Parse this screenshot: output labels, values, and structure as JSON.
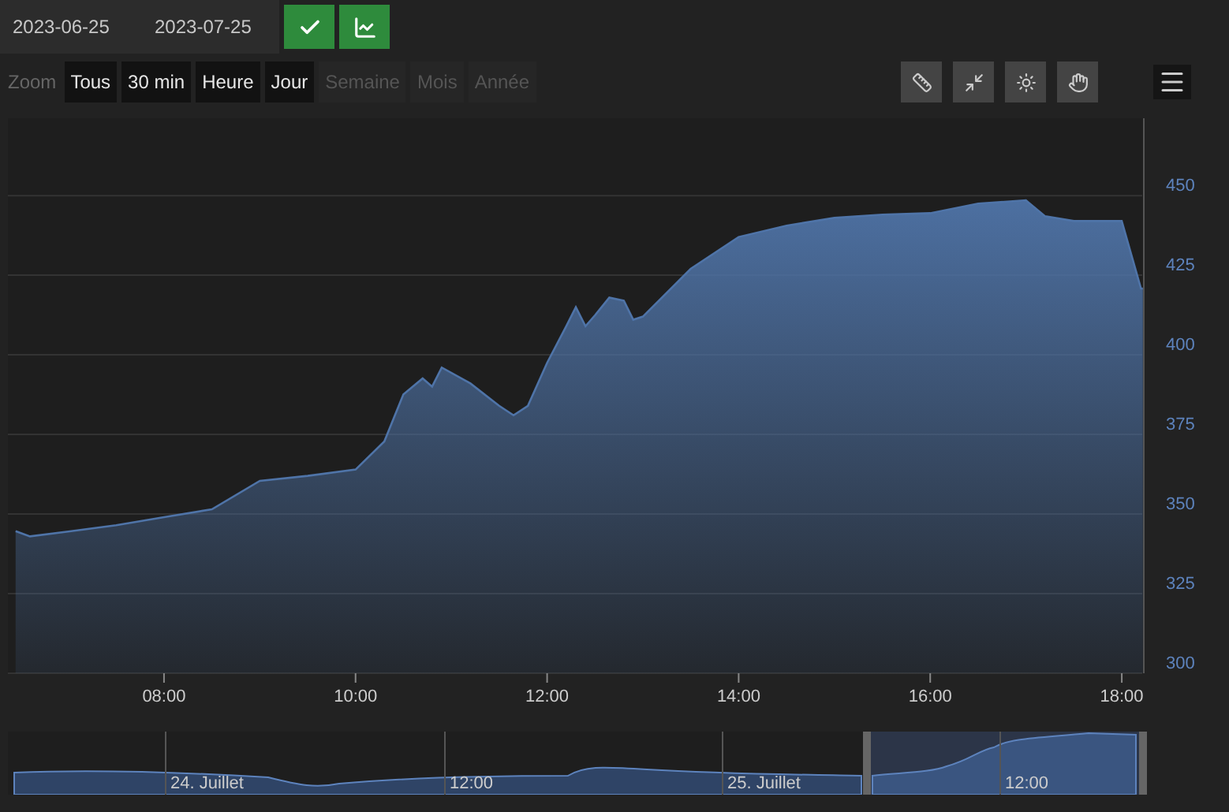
{
  "date_range": {
    "start": "2023-06-25",
    "end": "2023-07-25"
  },
  "zoom": {
    "label": "Zoom",
    "buttons": [
      {
        "label": "Tous",
        "disabled": false
      },
      {
        "label": "30 min",
        "disabled": false
      },
      {
        "label": "Heure",
        "disabled": false
      },
      {
        "label": "Jour",
        "disabled": false
      },
      {
        "label": "Semaine",
        "disabled": true
      },
      {
        "label": "Mois",
        "disabled": true
      },
      {
        "label": "Année",
        "disabled": true
      }
    ]
  },
  "chart": {
    "chart_data": {
      "type": "area",
      "x": [
        6.45,
        6.6,
        7.0,
        7.5,
        8.0,
        8.5,
        9.0,
        9.5,
        10.0,
        10.3,
        10.5,
        10.7,
        10.8,
        10.9,
        11.2,
        11.5,
        11.65,
        11.8,
        12.0,
        12.2,
        12.3,
        12.4,
        12.5,
        12.65,
        12.8,
        12.9,
        13.0,
        13.5,
        14.0,
        14.5,
        15.0,
        15.5,
        16.0,
        16.5,
        17.0,
        17.2,
        17.5,
        18.0,
        18.2,
        18.22
      ],
      "series": [
        {
          "color": "#4f74a8",
          "values": [
            344.6,
            343,
            344.5,
            346.5,
            349,
            351.5,
            360.4,
            362,
            364,
            372.8,
            387.6,
            392.6,
            390,
            396,
            391,
            384,
            381,
            384,
            397.5,
            409,
            415,
            409,
            412.4,
            418,
            417,
            411,
            412,
            427,
            437,
            440.6,
            443,
            444,
            444.5,
            447.5,
            448.5,
            443.5,
            442,
            442,
            420.8,
            420.8
          ]
        }
      ],
      "xlim": [
        6.37,
        18.23
      ],
      "ylim": [
        300,
        474.3
      ],
      "grid": true,
      "xticks": [
        {
          "value": 8,
          "label": "08:00"
        },
        {
          "value": 10,
          "label": "10:00"
        },
        {
          "value": 12,
          "label": "12:00"
        },
        {
          "value": 14,
          "label": "14:00"
        },
        {
          "value": 16,
          "label": "16:00"
        },
        {
          "value": 18,
          "label": "18:00"
        }
      ],
      "yticks": [
        300,
        325,
        350,
        375,
        400,
        425,
        450
      ]
    }
  },
  "navigator": {
    "labels": [
      "24. Juillet",
      "12:00",
      "25. Juillet",
      "12:00"
    ]
  }
}
